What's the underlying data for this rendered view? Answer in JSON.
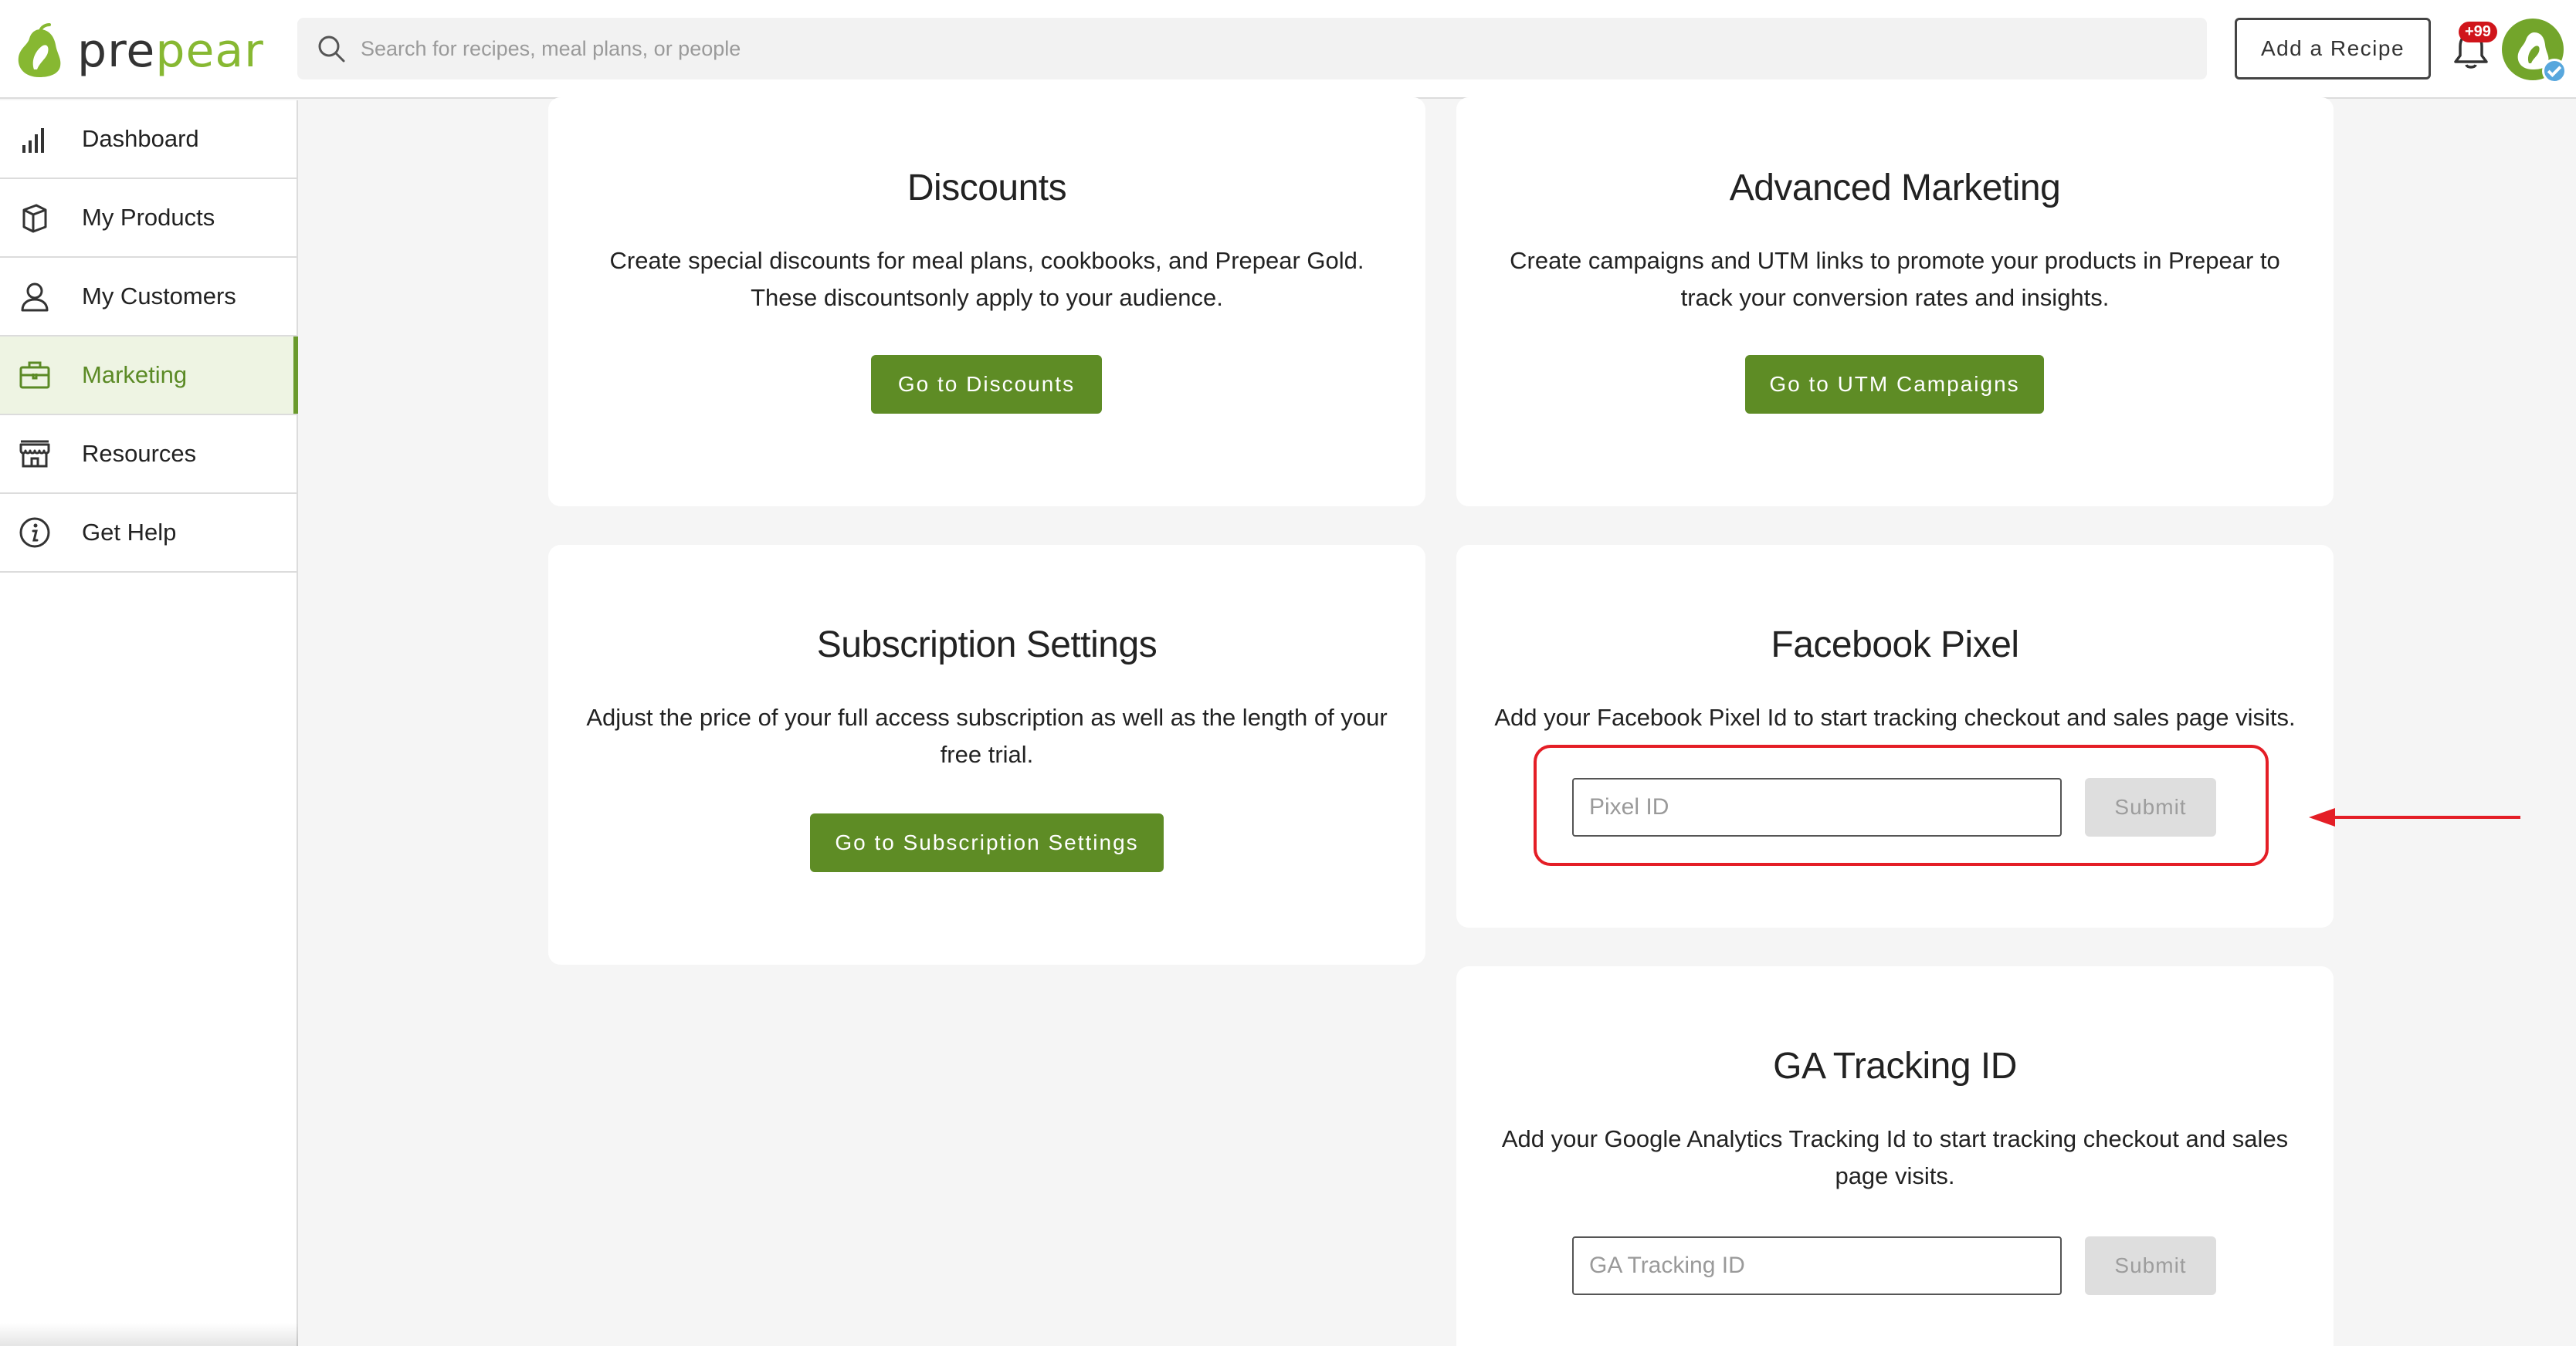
{
  "header": {
    "logo_text_prefix": "pre",
    "logo_text_accent": "pear",
    "search_placeholder": "Search for recipes, meal plans, or people",
    "add_recipe_label": "Add a Recipe",
    "notification_badge": "+99"
  },
  "sidebar": {
    "items": [
      {
        "label": "Dashboard",
        "icon": "bar-chart-icon"
      },
      {
        "label": "My Products",
        "icon": "box-icon"
      },
      {
        "label": "My Customers",
        "icon": "user-icon"
      },
      {
        "label": "Marketing",
        "icon": "briefcase-icon",
        "active": true
      },
      {
        "label": "Resources",
        "icon": "storefront-icon"
      },
      {
        "label": "Get Help",
        "icon": "info-icon"
      }
    ]
  },
  "cards": {
    "discounts": {
      "title": "Discounts",
      "line1": "Create special discounts for meal plans, cookbooks, and Prepear Gold.",
      "line2": "These discountsonly apply to your audience.",
      "button": "Go to Discounts"
    },
    "advanced_marketing": {
      "title": "Advanced Marketing",
      "line1": "Create campaigns and UTM links to promote your products in Prepear to",
      "line2": "track your conversion rates and insights.",
      "button": "Go to UTM Campaigns"
    },
    "subscription": {
      "title": "Subscription Settings",
      "line1": "Adjust the price of your full access subscription as well as the length of your",
      "line2": "free trial.",
      "button": "Go to Subscription Settings"
    },
    "facebook_pixel": {
      "title": "Facebook Pixel",
      "line1": "Add your Facebook Pixel Id to start tracking checkout and sales page visits.",
      "input_placeholder": "Pixel ID",
      "submit": "Submit"
    },
    "ga_tracking": {
      "title": "GA Tracking ID",
      "line1": "Add your Google Analytics Tracking Id to start tracking checkout and sales",
      "line2": "page visits.",
      "input_placeholder": "GA Tracking ID",
      "submit": "Submit"
    }
  },
  "colors": {
    "brand_green": "#5e8c25",
    "logo_green": "#87b832",
    "highlight_red": "#e41e26",
    "badge_red": "#d0151b"
  }
}
